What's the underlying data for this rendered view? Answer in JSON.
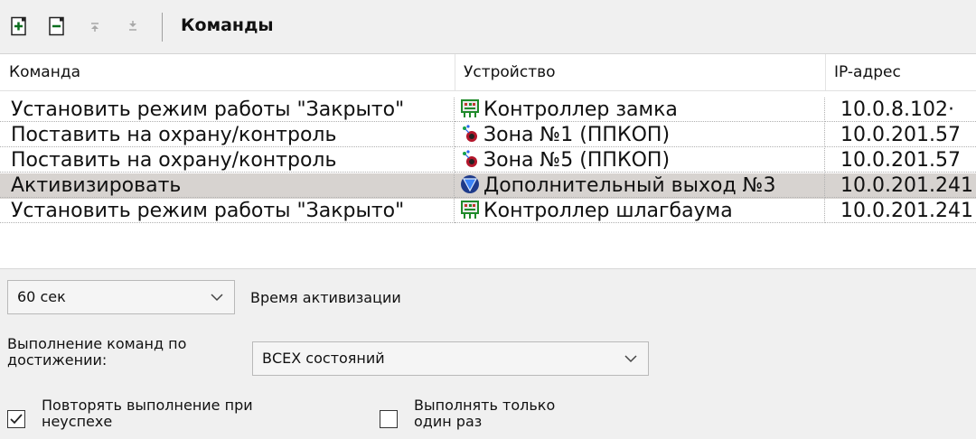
{
  "toolbar": {
    "title": "Команды",
    "buttons": [
      {
        "name": "add-icon",
        "enabled": true
      },
      {
        "name": "remove-icon",
        "enabled": true
      },
      {
        "name": "move-up-icon",
        "enabled": false
      },
      {
        "name": "move-down-icon",
        "enabled": false
      }
    ]
  },
  "grid": {
    "columns": [
      "Команда",
      "Устройство",
      "IP-адрес"
    ],
    "rows": [
      {
        "command": "Установить режим работы \"Закрыто\"",
        "device": "Контроллер замка",
        "device_icon": "controller-icon",
        "ip": "10.0.8.102·",
        "selected": false
      },
      {
        "command": "Поставить на охрану/контроль",
        "device": "Зона №1 (ППКОП)",
        "device_icon": "zone-icon",
        "ip": "10.0.201.57",
        "selected": false
      },
      {
        "command": "Поставить на охрану/контроль",
        "device": "Зона №5 (ППКОП)",
        "device_icon": "zone-icon",
        "ip": "10.0.201.57",
        "selected": false
      },
      {
        "command": "Активизировать",
        "device": "Дополнительный выход №3",
        "device_icon": "output-triangle-icon",
        "ip": "10.0.201.241",
        "selected": true
      },
      {
        "command": "Установить режим работы \"Закрыто\"",
        "device": "Контроллер шлагбаума",
        "device_icon": "controller-icon",
        "ip": "10.0.201.241",
        "selected": false
      }
    ]
  },
  "settings": {
    "activation_time_value": "60 сек",
    "activation_time_label": "Время активизации",
    "execution_label_line1": "Выполнение команд по",
    "execution_label_line2": "достижении:",
    "execution_value": "ВСЕХ состояний",
    "repeat_label_line1": "Повторять выполнение при",
    "repeat_label_line2": "неуспехе",
    "repeat_checked": true,
    "once_label_line1": "Выполнять только",
    "once_label_line2": "один раз",
    "once_checked": false
  },
  "colors": {
    "selected_row": "#d7d3d0",
    "toolbar_bg": "#f0f0f0",
    "panel_bg": "#f0f0f0",
    "icon_green": "#1f8a2a"
  }
}
